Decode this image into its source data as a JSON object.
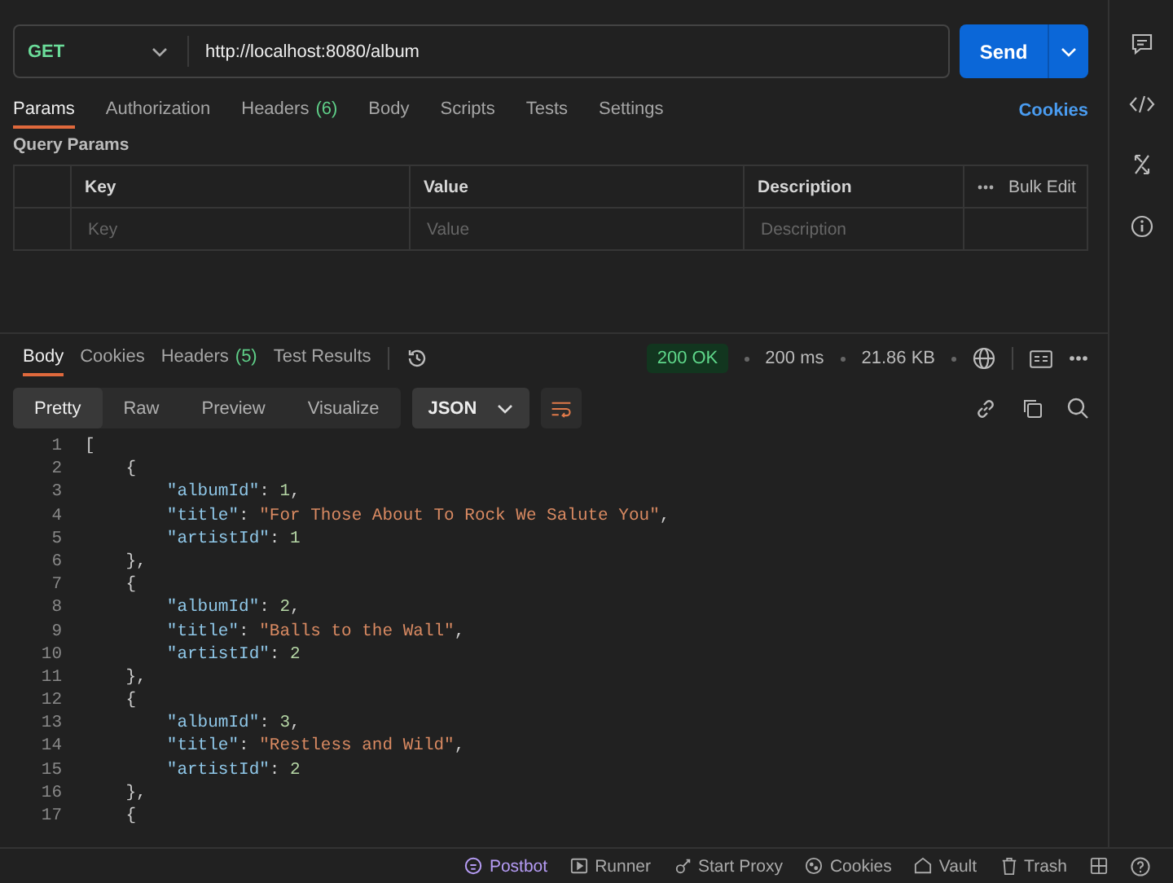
{
  "request": {
    "method": "GET",
    "url": "http://localhost:8080/album",
    "send": "Send"
  },
  "request_tabs": [
    {
      "label": "Params",
      "selected": true
    },
    {
      "label": "Authorization",
      "selected": false
    },
    {
      "label": "Headers",
      "count": "(6)",
      "selected": false
    },
    {
      "label": "Body",
      "selected": false
    },
    {
      "label": "Scripts",
      "selected": false
    },
    {
      "label": "Tests",
      "selected": false
    },
    {
      "label": "Settings",
      "selected": false
    }
  ],
  "cookies_link": "Cookies",
  "query_params": {
    "title": "Query Params",
    "columns": [
      "Key",
      "Value",
      "Description"
    ],
    "bulk_edit": "Bulk Edit",
    "placeholders": [
      "Key",
      "Value",
      "Description"
    ]
  },
  "response_tabs": [
    {
      "label": "Body",
      "selected": true
    },
    {
      "label": "Cookies",
      "selected": false
    },
    {
      "label": "Headers",
      "count": "(5)",
      "selected": false
    },
    {
      "label": "Test Results",
      "selected": false
    }
  ],
  "response_meta": {
    "status": "200 OK",
    "time": "200 ms",
    "size": "21.86 KB"
  },
  "view_modes": [
    {
      "label": "Pretty",
      "selected": true
    },
    {
      "label": "Raw",
      "selected": false
    },
    {
      "label": "Preview",
      "selected": false
    },
    {
      "label": "Visualize",
      "selected": false
    }
  ],
  "format": "JSON",
  "code_lines": [
    {
      "num": "1",
      "tokens": [
        {
          "kind": "punct",
          "text": "["
        }
      ]
    },
    {
      "num": "2",
      "tokens": [
        {
          "kind": "punct",
          "text": "    {"
        }
      ]
    },
    {
      "num": "3",
      "tokens": [
        {
          "kind": "key",
          "text": "        \"albumId\""
        },
        {
          "kind": "punct",
          "text": ": "
        },
        {
          "kind": "number",
          "text": "1"
        },
        {
          "kind": "punct",
          "text": ","
        }
      ]
    },
    {
      "num": "4",
      "tokens": [
        {
          "kind": "key",
          "text": "        \"title\""
        },
        {
          "kind": "punct",
          "text": ": "
        },
        {
          "kind": "string",
          "text": "\"For Those About To Rock We Salute You\""
        },
        {
          "kind": "punct",
          "text": ","
        }
      ]
    },
    {
      "num": "5",
      "tokens": [
        {
          "kind": "key",
          "text": "        \"artistId\""
        },
        {
          "kind": "punct",
          "text": ": "
        },
        {
          "kind": "number",
          "text": "1"
        }
      ]
    },
    {
      "num": "6",
      "tokens": [
        {
          "kind": "punct",
          "text": "    },"
        }
      ]
    },
    {
      "num": "7",
      "tokens": [
        {
          "kind": "punct",
          "text": "    {"
        }
      ]
    },
    {
      "num": "8",
      "tokens": [
        {
          "kind": "key",
          "text": "        \"albumId\""
        },
        {
          "kind": "punct",
          "text": ": "
        },
        {
          "kind": "number",
          "text": "2"
        },
        {
          "kind": "punct",
          "text": ","
        }
      ]
    },
    {
      "num": "9",
      "tokens": [
        {
          "kind": "key",
          "text": "        \"title\""
        },
        {
          "kind": "punct",
          "text": ": "
        },
        {
          "kind": "string",
          "text": "\"Balls to the Wall\""
        },
        {
          "kind": "punct",
          "text": ","
        }
      ]
    },
    {
      "num": "10",
      "tokens": [
        {
          "kind": "key",
          "text": "        \"artistId\""
        },
        {
          "kind": "punct",
          "text": ": "
        },
        {
          "kind": "number",
          "text": "2"
        }
      ]
    },
    {
      "num": "11",
      "tokens": [
        {
          "kind": "punct",
          "text": "    },"
        }
      ]
    },
    {
      "num": "12",
      "tokens": [
        {
          "kind": "punct",
          "text": "    {"
        }
      ]
    },
    {
      "num": "13",
      "tokens": [
        {
          "kind": "key",
          "text": "        \"albumId\""
        },
        {
          "kind": "punct",
          "text": ": "
        },
        {
          "kind": "number",
          "text": "3"
        },
        {
          "kind": "punct",
          "text": ","
        }
      ]
    },
    {
      "num": "14",
      "tokens": [
        {
          "kind": "key",
          "text": "        \"title\""
        },
        {
          "kind": "punct",
          "text": ": "
        },
        {
          "kind": "string",
          "text": "\"Restless and Wild\""
        },
        {
          "kind": "punct",
          "text": ","
        }
      ]
    },
    {
      "num": "15",
      "tokens": [
        {
          "kind": "key",
          "text": "        \"artistId\""
        },
        {
          "kind": "punct",
          "text": ": "
        },
        {
          "kind": "number",
          "text": "2"
        }
      ]
    },
    {
      "num": "16",
      "tokens": [
        {
          "kind": "punct",
          "text": "    },"
        }
      ]
    },
    {
      "num": "17",
      "tokens": [
        {
          "kind": "punct",
          "text": "    {"
        }
      ]
    }
  ],
  "status_bar": [
    {
      "label": "Postbot",
      "kind": "postbot"
    },
    {
      "label": "Runner",
      "kind": "runner"
    },
    {
      "label": "Start Proxy",
      "kind": "proxy"
    },
    {
      "label": "Cookies",
      "kind": "cookie"
    },
    {
      "label": "Vault",
      "kind": "vault"
    },
    {
      "label": "Trash",
      "kind": "trash"
    }
  ]
}
